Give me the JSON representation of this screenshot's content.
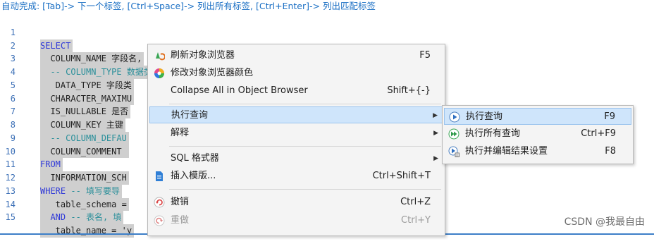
{
  "hint": "自动完成: [Tab]-> 下一个标签, [Ctrl+Space]-> 列出所有标签, [Ctrl+Enter]-> 列出匹配标签",
  "editor": {
    "lines": [
      {
        "n": "1",
        "text": "SELECT",
        "kind": "kw"
      },
      {
        "n": "2",
        "text": "  COLUMN_NAME 字段名,",
        "kind": "code"
      },
      {
        "n": "3",
        "text": "  -- COLUMN_TYPE 数据类型,",
        "kind": "cm"
      },
      {
        "n": "4",
        "text": "   DATA_TYPE 字段类",
        "kind": "code"
      },
      {
        "n": "5",
        "text": "  CHARACTER_MAXIMU",
        "kind": "code"
      },
      {
        "n": "6",
        "text": "  IS_NULLABLE 是否",
        "kind": "code"
      },
      {
        "n": "7",
        "text": "  COLUMN_KEY 主键",
        "kind": "code"
      },
      {
        "n": "8",
        "text": "  -- COLUMN_DEFAU",
        "kind": "cm"
      },
      {
        "n": "9",
        "text": "  COLUMN_COMMENT ",
        "kind": "code"
      },
      {
        "n": "10",
        "text": "FROM",
        "kind": "kw"
      },
      {
        "n": "11",
        "text": "  INFORMATION_SCH",
        "kind": "code"
      },
      {
        "n": "12",
        "text": "WHERE -- 填写要导",
        "kind": "mixed",
        "kw": "WHERE",
        "rest": " -- 填写要导"
      },
      {
        "n": "13",
        "text": "   table_schema =",
        "kind": "code"
      },
      {
        "n": "14",
        "text": "  AND -- 表名, 填",
        "kind": "mixed",
        "kw": "  AND",
        "rest": " -- 表名, 填"
      },
      {
        "n": "15",
        "text": "   table_name = 'y",
        "kind": "code"
      }
    ]
  },
  "context_menu": {
    "items": [
      {
        "label": "刷新对象浏览器",
        "shortcut": "F5",
        "icon": "refresh-icon"
      },
      {
        "label": "修改对象浏览器颜色",
        "shortcut": "",
        "icon": "color-wheel-icon"
      },
      {
        "label": "Collapse All in Object Browser",
        "shortcut": "Shift+{-}",
        "icon": ""
      },
      {
        "label": "执行查询",
        "shortcut": "",
        "icon": "",
        "submenu": true
      },
      {
        "label": "解释",
        "shortcut": "",
        "icon": "",
        "submenu": true
      },
      {
        "label": "SQL 格式器",
        "shortcut": "",
        "icon": "",
        "submenu": true
      },
      {
        "label": "插入模版...",
        "shortcut": "Ctrl+Shift+T",
        "icon": "template-icon"
      },
      {
        "label": "撤销",
        "shortcut": "Ctrl+Z",
        "icon": "undo-icon"
      },
      {
        "label": "重做",
        "shortcut": "Ctrl+Y",
        "icon": "redo-icon"
      }
    ]
  },
  "submenu": {
    "items": [
      {
        "label": "执行查询",
        "shortcut": "F9",
        "icon": "play-icon"
      },
      {
        "label": "执行所有查询",
        "shortcut": "Ctrl+F9",
        "icon": "play-all-icon"
      },
      {
        "label": "执行并编辑结果设置",
        "shortcut": "F8",
        "icon": "play-edit-icon"
      }
    ]
  },
  "watermark": "CSDN @我最自由",
  "colors": {
    "keyword": "#2f39d8",
    "comment": "#2a8f9a",
    "line_number": "#3b6fb6",
    "selection": "#cfcfcf",
    "highlight": "#cfe5fb"
  }
}
